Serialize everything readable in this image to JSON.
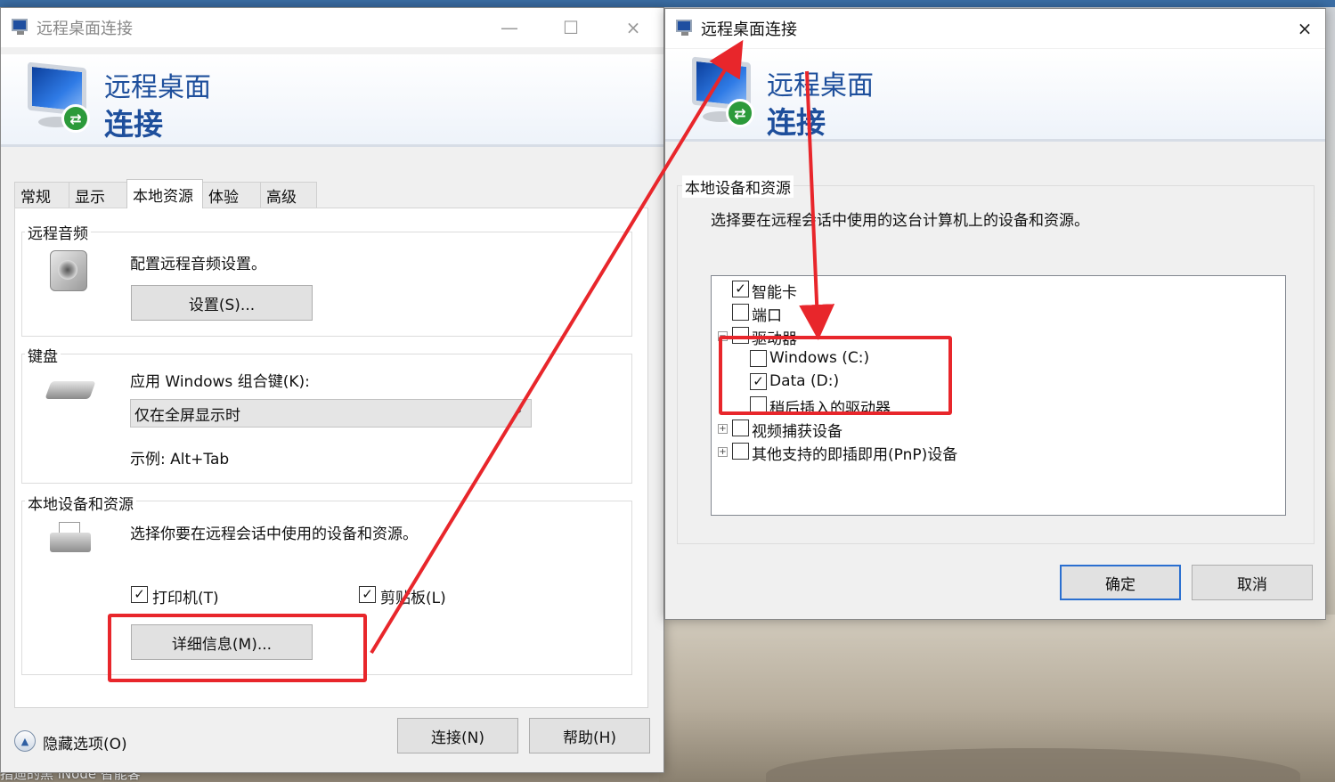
{
  "desktop": {
    "bottom_text": "指迪的黑 iNode 智能客"
  },
  "window_left": {
    "title": "远程桌面连接",
    "banner_line1": "远程桌面",
    "banner_line2": "连接",
    "tabs": [
      {
        "label": "常规"
      },
      {
        "label": "显示"
      },
      {
        "label": "本地资源",
        "active": true
      },
      {
        "label": "体验"
      },
      {
        "label": "高级"
      }
    ],
    "audio": {
      "group_label": "远程音频",
      "description": "配置远程音频设置。",
      "settings_button": "设置(S)..."
    },
    "keyboard": {
      "group_label": "键盘",
      "apply_label": "应用 Windows 组合键(K):",
      "selected_option": "仅在全屏显示时",
      "example": "示例: Alt+Tab"
    },
    "devices": {
      "group_label": "本地设备和资源",
      "description": "选择你要在远程会话中使用的设备和资源。",
      "printer_label": "打印机(T)",
      "printer_checked": true,
      "clipboard_label": "剪贴板(L)",
      "clipboard_checked": true,
      "more_button": "详细信息(M)..."
    },
    "hide_options": "隐藏选项(O)",
    "connect_button": "连接(N)",
    "help_button": "帮助(H)"
  },
  "window_right": {
    "title": "远程桌面连接",
    "banner_line1": "远程桌面",
    "banner_line2": "连接",
    "group_label": "本地设备和资源",
    "description": "选择要在远程会话中使用的这台计算机上的设备和资源。",
    "tree": {
      "smartcard": {
        "label": "智能卡",
        "checked": true
      },
      "ports": {
        "label": "端口",
        "checked": false
      },
      "drives": {
        "label": "驱动器",
        "checked": false,
        "expander": "−"
      },
      "drive_c": {
        "label": "Windows (C:)",
        "checked": false
      },
      "drive_d": {
        "label": "Data (D:)",
        "checked": true
      },
      "later_drives": {
        "label": "稍后插入的驱动器",
        "checked": false
      },
      "video": {
        "label": "视频捕获设备",
        "checked": false,
        "expander": "+"
      },
      "pnp": {
        "label": "其他支持的即插即用(PnP)设备",
        "checked": false,
        "expander": "+"
      }
    },
    "ok_button": "确定",
    "cancel_button": "取消"
  },
  "annotations": {
    "color": "#e8262b"
  },
  "icons": {
    "close": "×",
    "minimize": "—",
    "maximize": "☐",
    "check": "✓",
    "chevron_down": "⌄",
    "collapse_up": "▲",
    "connection_badge": "⇄"
  }
}
